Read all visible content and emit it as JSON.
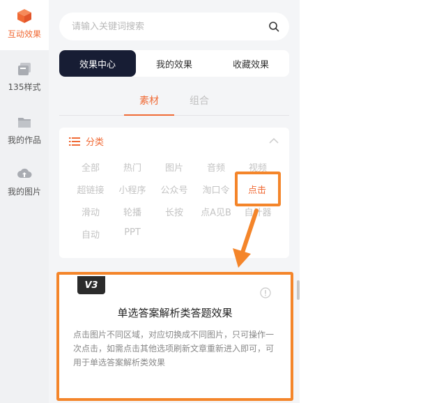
{
  "rail": {
    "items": [
      {
        "label": "互动效果",
        "icon": "cube-icon",
        "active": true
      },
      {
        "label": "135样式",
        "icon": "style-icon",
        "active": false
      },
      {
        "label": "我的作品",
        "icon": "folder-icon",
        "active": false
      },
      {
        "label": "我的图片",
        "icon": "cloud-upload-icon",
        "active": false
      }
    ]
  },
  "search": {
    "placeholder": "请输入关键词搜索"
  },
  "segments": [
    {
      "label": "效果中心",
      "active": true
    },
    {
      "label": "我的效果",
      "active": false
    },
    {
      "label": "收藏效果",
      "active": false
    }
  ],
  "subtabs": [
    {
      "label": "素材",
      "active": true
    },
    {
      "label": "组合",
      "active": false
    }
  ],
  "category": {
    "title": "分类",
    "tags": [
      "全部",
      "热门",
      "图片",
      "音频",
      "视频",
      "超链接",
      "小程序",
      "公众号",
      "淘口令",
      "点击",
      "滑动",
      "轮播",
      "长按",
      "点A见B",
      "自计器",
      "自动",
      "PPT"
    ],
    "selected": "点击"
  },
  "effect": {
    "badge": "V3",
    "title": "单选答案解析类答题效果",
    "description": "点击图片不同区域，对应切换成不同图片，只可操作一次点击，如需点击其他选项刷新文章重新进入即可，可用于单选答案解析类效果"
  },
  "colors": {
    "accent": "#f06a35",
    "highlight": "#f4852a",
    "dark": "#171d34"
  }
}
